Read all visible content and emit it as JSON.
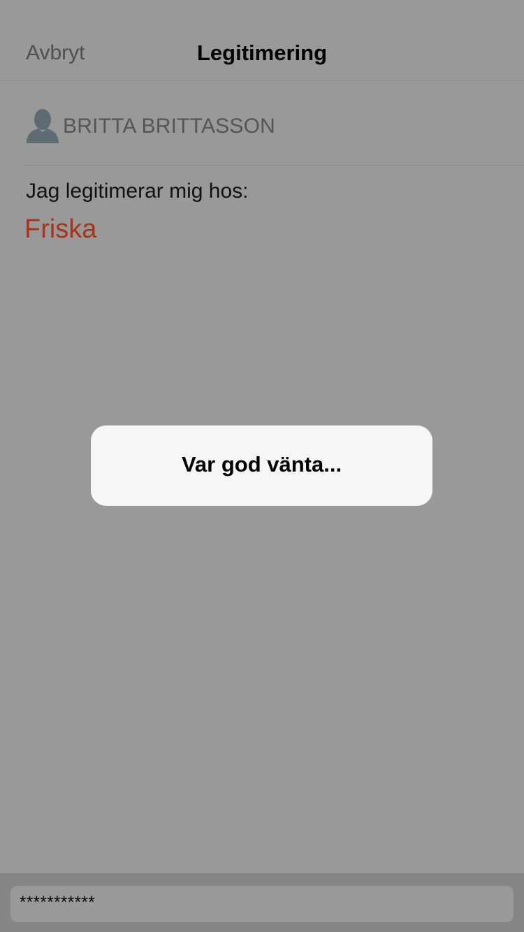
{
  "nav": {
    "cancel_label": "Avbryt",
    "title": "Legitimering"
  },
  "user": {
    "icon": "person-icon",
    "name": "BRITTA BRITTASSON"
  },
  "content": {
    "intro_text": "Jag legitimerar mig hos:",
    "provider_name": "Friska"
  },
  "modal": {
    "message": "Var god vänta..."
  },
  "password": {
    "masked_value": "***********"
  },
  "colors": {
    "overlay_background": "#999999",
    "accent": "#a8341c",
    "modal_background": "#f6f6f6"
  }
}
